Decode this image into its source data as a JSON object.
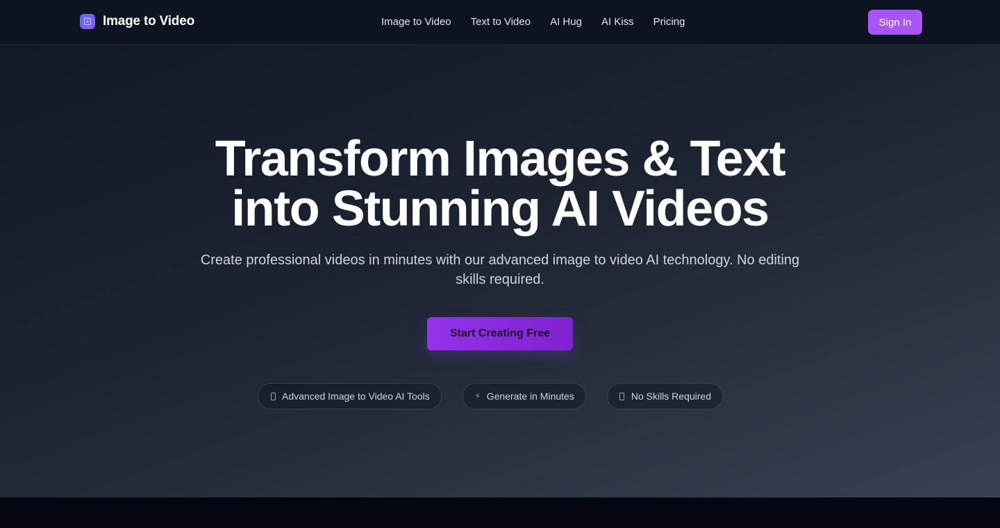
{
  "header": {
    "brand_name": "Image to Video",
    "brand_icon": "video-logo-icon",
    "nav": [
      {
        "label": "Image to Video"
      },
      {
        "label": "Text to Video"
      },
      {
        "label": "AI Hug"
      },
      {
        "label": "AI Kiss"
      },
      {
        "label": "Pricing"
      }
    ],
    "signin_label": "Sign In"
  },
  "hero": {
    "title_line1": "Transform Images & Text",
    "title_line2": "into Stunning AI Videos",
    "subtitle": "Create professional videos in minutes with our advanced image to video AI technology. No editing skills required.",
    "cta_label": "Start Creating Free",
    "features": [
      {
        "icon": "box-icon",
        "label": "Advanced Image to Video AI Tools"
      },
      {
        "icon": "lightning-icon",
        "label": "Generate in Minutes"
      },
      {
        "icon": "box-icon",
        "label": "No Skills Required"
      }
    ]
  },
  "colors": {
    "accent": "#a855f7",
    "cta": "#9333ea",
    "header_bg": "#0d1321",
    "hero_bg_start": "#111827",
    "hero_bg_end": "#374151"
  }
}
